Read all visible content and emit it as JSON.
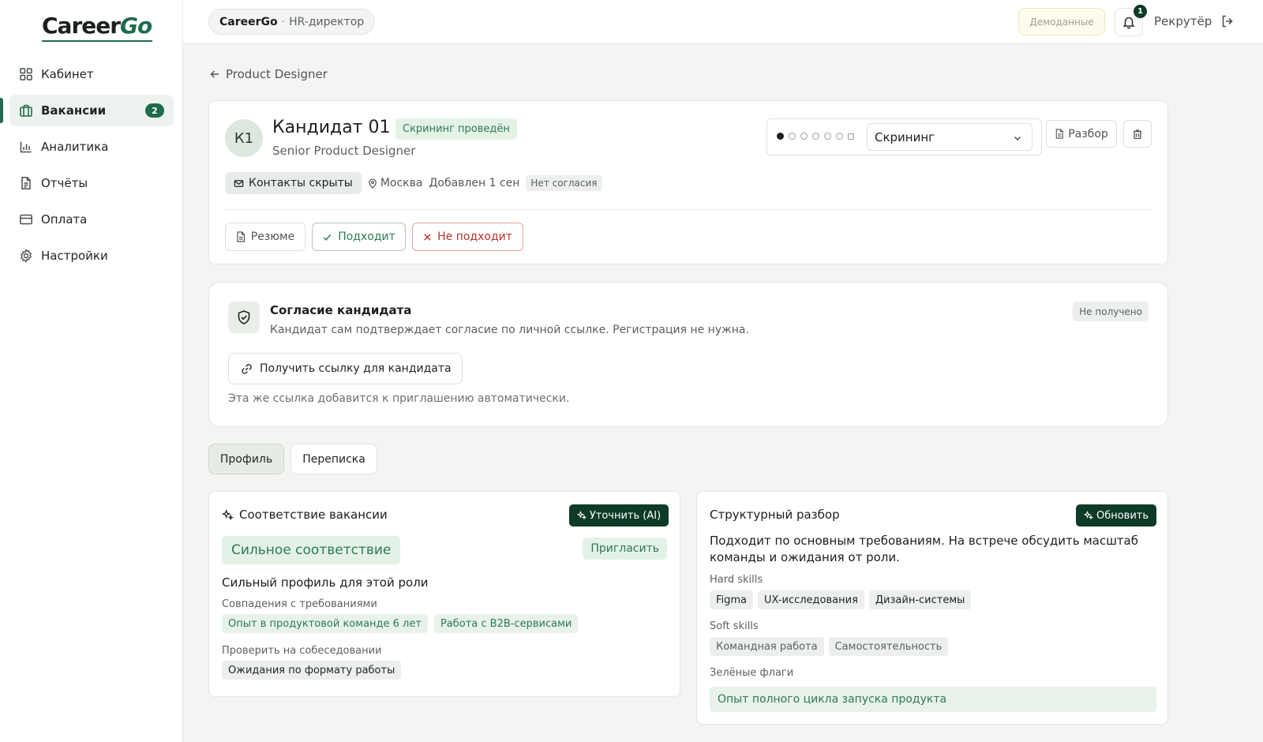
{
  "sidebar": {
    "logo_main": "Career",
    "logo_accent": "Go",
    "items": [
      {
        "label": "Кабинет",
        "icon": "grid-icon"
      },
      {
        "label": "Вакансии",
        "icon": "briefcase-icon",
        "badge": "2",
        "active": true
      },
      {
        "label": "Аналитика",
        "icon": "bar-chart-icon"
      },
      {
        "label": "Отчёты",
        "icon": "document-icon"
      },
      {
        "label": "Оплата",
        "icon": "credit-card-icon"
      },
      {
        "label": "Настройки",
        "icon": "gear-icon"
      }
    ]
  },
  "header": {
    "company": "CareerGo",
    "separator": "·",
    "role": "HR-директор",
    "demo_label": "Демоданные",
    "notifications_count": "1",
    "user": "Рекрутёр"
  },
  "back": {
    "label": "Product Designer"
  },
  "candidate": {
    "initials": "К1",
    "name": "Кандидат 01",
    "status": "Скрининг проведён",
    "role": "Senior Product Designer",
    "contacts_label": "Контакты скрыты",
    "location": "Москва",
    "added": "Добавлен 1 сен",
    "consent_status": "Нет согласия",
    "stage": "Скрининг",
    "stage_progress": {
      "current": 1,
      "total": 7
    },
    "analysis_label": "Разбор",
    "actions": {
      "resume": "Резюме",
      "fit": "Подходит",
      "not_fit": "Не подходит"
    }
  },
  "consent": {
    "title": "Согласие кандидата",
    "description": "Кандидат сам подтверждает согласие по личной ссылке. Регистрация не нужна.",
    "status": "Не получено",
    "link_button": "Получить ссылку для кандидата",
    "note": "Эта же ссылка добавится к приглашению автоматически."
  },
  "tabs": [
    {
      "label": "Профиль",
      "active": true
    },
    {
      "label": "Переписка",
      "active": false
    }
  ],
  "match": {
    "title": "Соответствие вакансии",
    "refine_button": "Уточнить (AI)",
    "verdict": "Сильное соответствие",
    "invite": "Пригласить",
    "headline": "Сильный профиль для этой роли",
    "matches_label": "Совпадения с требованиями",
    "matches": [
      "Опыт в продуктовой команде 6 лет",
      "Работа с B2B-сервисами"
    ],
    "check_label": "Проверить на собеседовании",
    "check": [
      "Ожидания по формату работы"
    ]
  },
  "structure": {
    "title": "Структурный разбор",
    "refresh_button": "Обновить",
    "summary": "Подходит по основным требованиям. На встрече обсудить масштаб команды и ожидания от роли.",
    "hard_label": "Hard skills",
    "hard": [
      "Figma",
      "UX-исследования",
      "Дизайн-системы"
    ],
    "soft_label": "Soft skills",
    "soft": [
      "Командная работа",
      "Самостоятельность"
    ],
    "flags_label": "Зелёные флаги",
    "flags": [
      "Опыт полного цикла запуска продукта"
    ]
  },
  "colors": {
    "brand": "#1e6b4d",
    "brand_dark": "#0e3a28",
    "success_bg": "#e4f1e7",
    "danger": "#b4322b"
  }
}
